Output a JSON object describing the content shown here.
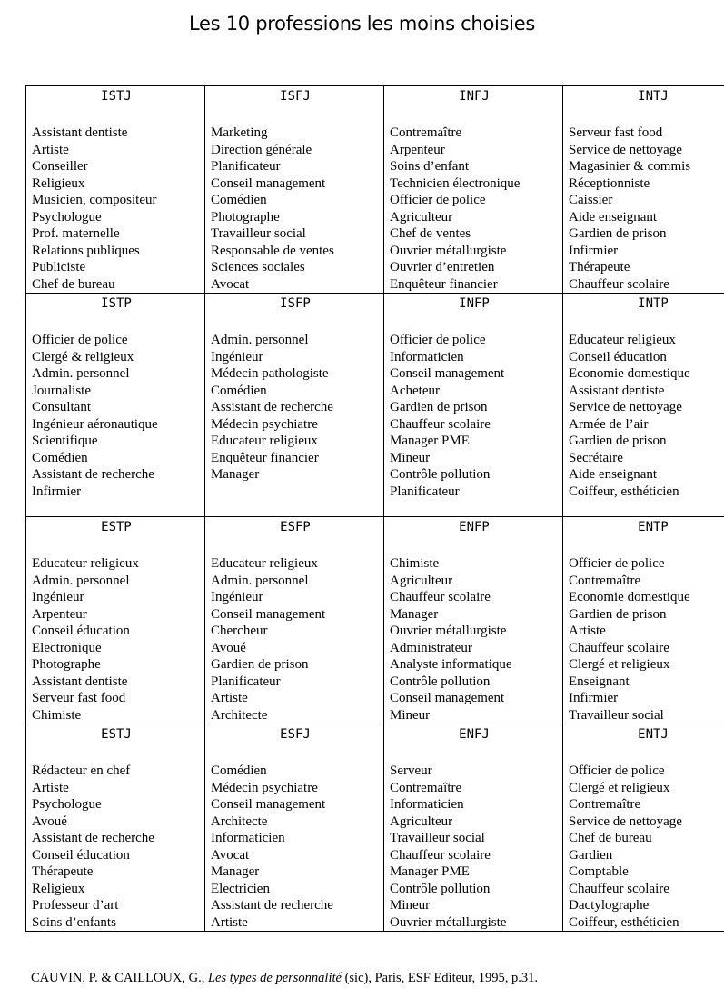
{
  "title": "Les 10 professions les moins choisies",
  "rows": [
    [
      {
        "type": "ISTJ",
        "jobs": [
          "Assistant dentiste",
          "Artiste",
          "Conseiller",
          "Religieux",
          "Musicien, compositeur",
          "Psychologue",
          "Prof. maternelle",
          "Relations publiques",
          "Publiciste",
          "Chef de bureau"
        ]
      },
      {
        "type": "ISFJ",
        "jobs": [
          "Marketing",
          "Direction générale",
          "Planificateur",
          "Conseil management",
          "Comédien",
          "Photographe",
          "Travailleur social",
          "Responsable de ventes",
          "Sciences sociales",
          "Avocat"
        ]
      },
      {
        "type": "INFJ",
        "jobs": [
          "Contremaître",
          "Arpenteur",
          "Soins d’enfant",
          "Technicien électronique",
          "Officier de police",
          "Agriculteur",
          "Chef de ventes",
          "Ouvrier métallurgiste",
          "Ouvrier d’entretien",
          "Enquêteur financier"
        ]
      },
      {
        "type": "INTJ",
        "jobs": [
          "Serveur fast food",
          "Service de nettoyage",
          "Magasinier & commis",
          "Réceptionniste",
          "Caissier",
          "Aide enseignant",
          "Gardien de prison",
          "Infirmier",
          "Thérapeute",
          "Chauffeur scolaire"
        ]
      }
    ],
    [
      {
        "type": "ISTP",
        "jobs": [
          "Officier de police",
          "Clergé & religieux",
          "Admin. personnel",
          "Journaliste",
          "Consultant",
          "Ingénieur aéronautique",
          "Scientifique",
          "Comédien",
          "Assistant de recherche",
          "Infirmier"
        ]
      },
      {
        "type": "ISFP",
        "jobs": [
          "Admin. personnel",
          "Ingénieur",
          "Médecin pathologiste",
          "Comédien",
          "Assistant de recherche",
          "Médecin psychiatre",
          "Educateur religieux",
          "Enquêteur financier",
          "Manager"
        ]
      },
      {
        "type": "INFP",
        "jobs": [
          "Officier de police",
          "Informaticien",
          "Conseil management",
          "Acheteur",
          "Gardien de prison",
          "Chauffeur scolaire",
          "Manager PME",
          "Mineur",
          "Contrôle pollution",
          "Planificateur"
        ]
      },
      {
        "type": "INTP",
        "jobs": [
          "Educateur religieux",
          "Conseil éducation",
          "Economie domestique",
          "Assistant dentiste",
          "Service de nettoyage",
          "Armée de l’air",
          "Gardien de prison",
          "Secrétaire",
          "Aide enseignant",
          "Coiffeur, esthéticien"
        ]
      }
    ],
    [
      {
        "type": "ESTP",
        "jobs": [
          "Educateur religieux",
          "Admin. personnel",
          "Ingénieur",
          "Arpenteur",
          "Conseil éducation",
          "Electronique",
          "Photographe",
          "Assistant dentiste",
          "Serveur fast food",
          "Chimiste"
        ]
      },
      {
        "type": "ESFP",
        "jobs": [
          "Educateur religieux",
          "Admin. personnel",
          "Ingénieur",
          "Conseil management",
          "Chercheur",
          "Avoué",
          "Gardien de prison",
          "Planificateur",
          "Artiste",
          "Architecte"
        ]
      },
      {
        "type": "ENFP",
        "jobs": [
          "Chimiste",
          "Agriculteur",
          "Chauffeur scolaire",
          "Manager",
          "Ouvrier métallurgiste",
          "Administrateur",
          "Analyste informatique",
          "Contrôle pollution",
          "Conseil management",
          "Mineur"
        ]
      },
      {
        "type": "ENTP",
        "jobs": [
          "Officier de police",
          "Contremaître",
          "Economie domestique",
          "Gardien de prison",
          "Artiste",
          "Chauffeur scolaire",
          "Clergé et religieux",
          "Enseignant",
          "Infirmier",
          "Travailleur social"
        ]
      }
    ],
    [
      {
        "type": "ESTJ",
        "jobs": [
          "Rédacteur en chef",
          "Artiste",
          "Psychologue",
          "Avoué",
          "Assistant de recherche",
          "Conseil éducation",
          "Thérapeute",
          "Religieux",
          "Professeur d’art",
          "Soins d’enfants"
        ]
      },
      {
        "type": "ESFJ",
        "jobs": [
          "Comédien",
          "Médecin psychiatre",
          "Conseil management",
          "Architecte",
          "Informaticien",
          "Avocat",
          "Manager",
          "Electricien",
          "Assistant de recherche",
          "Artiste"
        ]
      },
      {
        "type": "ENFJ",
        "jobs": [
          "Serveur",
          "Contremaître",
          "Informaticien",
          "Agriculteur",
          "Travailleur social",
          "Chauffeur scolaire",
          "Manager PME",
          "Contrôle pollution",
          "Mineur",
          "Ouvrier métallurgiste"
        ]
      },
      {
        "type": "ENTJ",
        "jobs": [
          "Officier de police",
          "Clergé et religieux",
          "Contremaître",
          "Service de nettoyage",
          "Chef de bureau",
          "Gardien",
          "Comptable",
          "Chauffeur scolaire",
          "Dactylographe",
          "Coiffeur, esthéticien"
        ]
      }
    ]
  ],
  "citation": {
    "authors": "CAUVIN, P. & CAILLOUX, G., ",
    "book_title": "Les types de personnalité",
    "rest": " (sic), Paris, ESF Editeur, 1995, p.31."
  }
}
